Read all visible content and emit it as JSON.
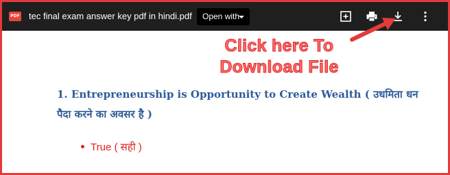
{
  "toolbar": {
    "badge_text": "PDF",
    "file_name": "tec final exam answer key pdf in hindi.pdf",
    "open_with_label": "Open with",
    "icons": [
      "add-to-drive-icon",
      "print-icon",
      "download-icon",
      "more-vert-icon"
    ]
  },
  "annotation": {
    "line1": "Click here To",
    "line2": "Download File",
    "color": "#ff6b6b"
  },
  "document": {
    "question": "1. Entrepreneurship is Opportunity to Create Wealth ( उधमिता धन पैदा करने का अवसर है )",
    "answer": "True ( सही )",
    "question_color": "#2e5c99",
    "answer_color": "#e02020"
  }
}
